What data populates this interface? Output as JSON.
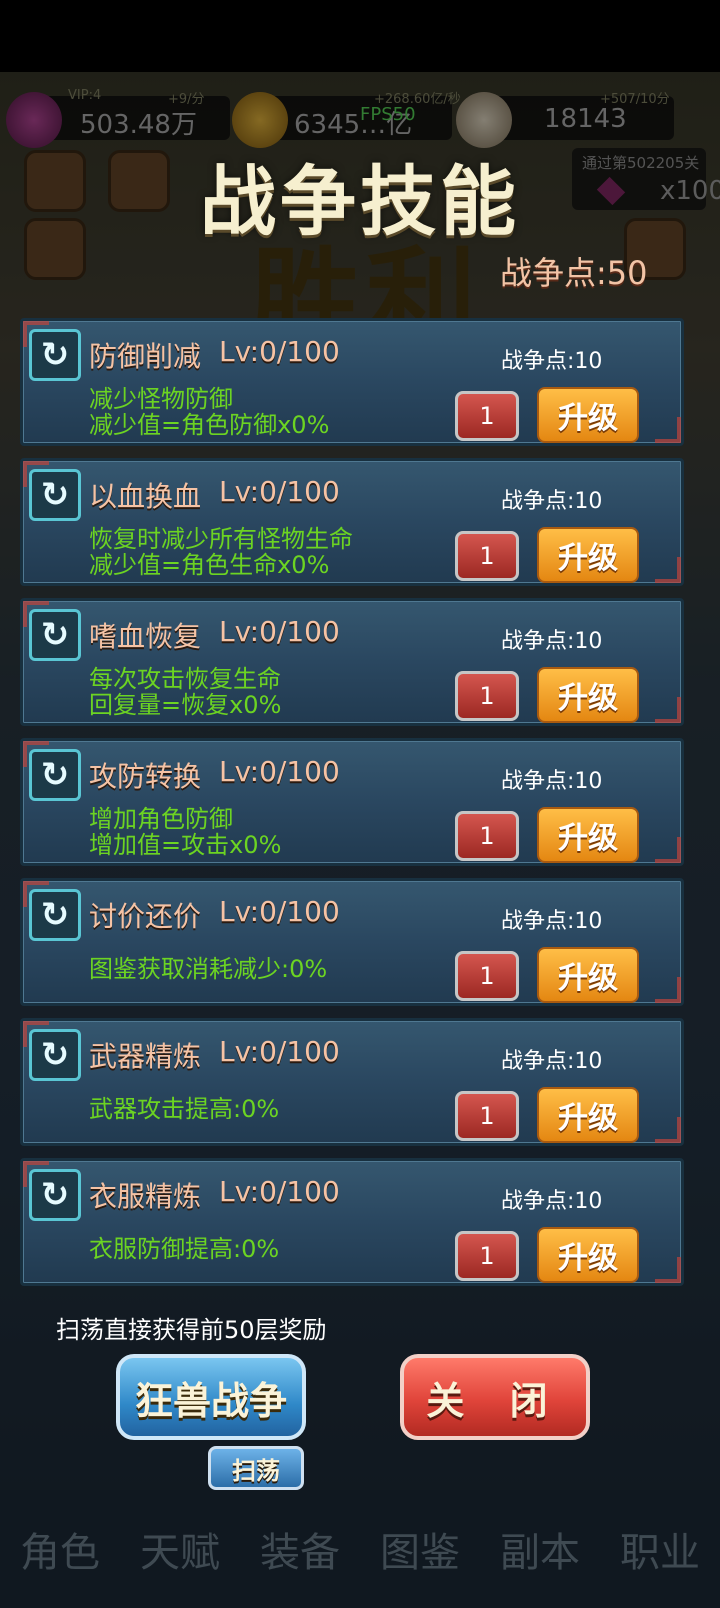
{
  "hud": {
    "vip_label": "VIP:4",
    "gem_rate": "+9/分",
    "gems": "503.48万",
    "gold_rate": "+268.60亿/秒",
    "gold": "6345…亿",
    "fps": "FPS50",
    "skull_rate": "+507/10分",
    "skulls": "18143",
    "pass_reward_title": "通过第502205关",
    "pass_reward_amount": "x100",
    "bg_victory": "胜利"
  },
  "panel": {
    "title": "战争技能",
    "war_points": "战争点:50"
  },
  "skills": [
    {
      "icon": "refresh-icon",
      "glyph": "↻",
      "name": "防御削减",
      "level": "Lv:0/100",
      "cost": "战争点:10",
      "desc": [
        "减少怪物防御",
        "减少值=角色防御x0%"
      ],
      "qty": "1",
      "upgrade_label": "升级"
    },
    {
      "icon": "refresh-icon",
      "glyph": "↻",
      "name": "以血换血",
      "level": "Lv:0/100",
      "cost": "战争点:10",
      "desc": [
        "恢复时减少所有怪物生命",
        "减少值=角色生命x0%"
      ],
      "qty": "1",
      "upgrade_label": "升级"
    },
    {
      "icon": "refresh-icon",
      "glyph": "↻",
      "name": "嗜血恢复",
      "level": "Lv:0/100",
      "cost": "战争点:10",
      "desc": [
        "每次攻击恢复生命",
        "回复量=恢复x0%"
      ],
      "qty": "1",
      "upgrade_label": "升级"
    },
    {
      "icon": "refresh-icon",
      "glyph": "↻",
      "name": "攻防转换",
      "level": "Lv:0/100",
      "cost": "战争点:10",
      "desc": [
        "增加角色防御",
        "增加值=攻击x0%"
      ],
      "qty": "1",
      "upgrade_label": "升级"
    },
    {
      "icon": "refresh-icon",
      "glyph": "↻",
      "name": "讨价还价",
      "level": "Lv:0/100",
      "cost": "战争点:10",
      "desc": [
        "图鉴获取消耗减少:0%"
      ],
      "qty": "1",
      "upgrade_label": "升级"
    },
    {
      "icon": "refresh-icon",
      "glyph": "↻",
      "name": "武器精炼",
      "level": "Lv:0/100",
      "cost": "战争点:10",
      "desc": [
        "武器攻击提高:0%"
      ],
      "qty": "1",
      "upgrade_label": "升级"
    },
    {
      "icon": "refresh-icon",
      "glyph": "↻",
      "name": "衣服精炼",
      "level": "Lv:0/100",
      "cost": "战争点:10",
      "desc": [
        "衣服防御提高:0%"
      ],
      "qty": "1",
      "upgrade_label": "升级"
    }
  ],
  "footer": {
    "sweep_note": "扫荡直接获得前50层奖励",
    "beast_war_label": "狂兽战争",
    "close_label": "关 闭",
    "sweep_label": "扫荡"
  },
  "nav": [
    "角色",
    "天赋",
    "装备",
    "图鉴",
    "副本",
    "职业"
  ],
  "colors": {
    "title": "#f6efcf",
    "skill_name": "#f5c3a5",
    "desc": "#6cd422",
    "upgrade": "#ffbe47",
    "close": "#e0443a",
    "beast": "#2f88c8"
  }
}
